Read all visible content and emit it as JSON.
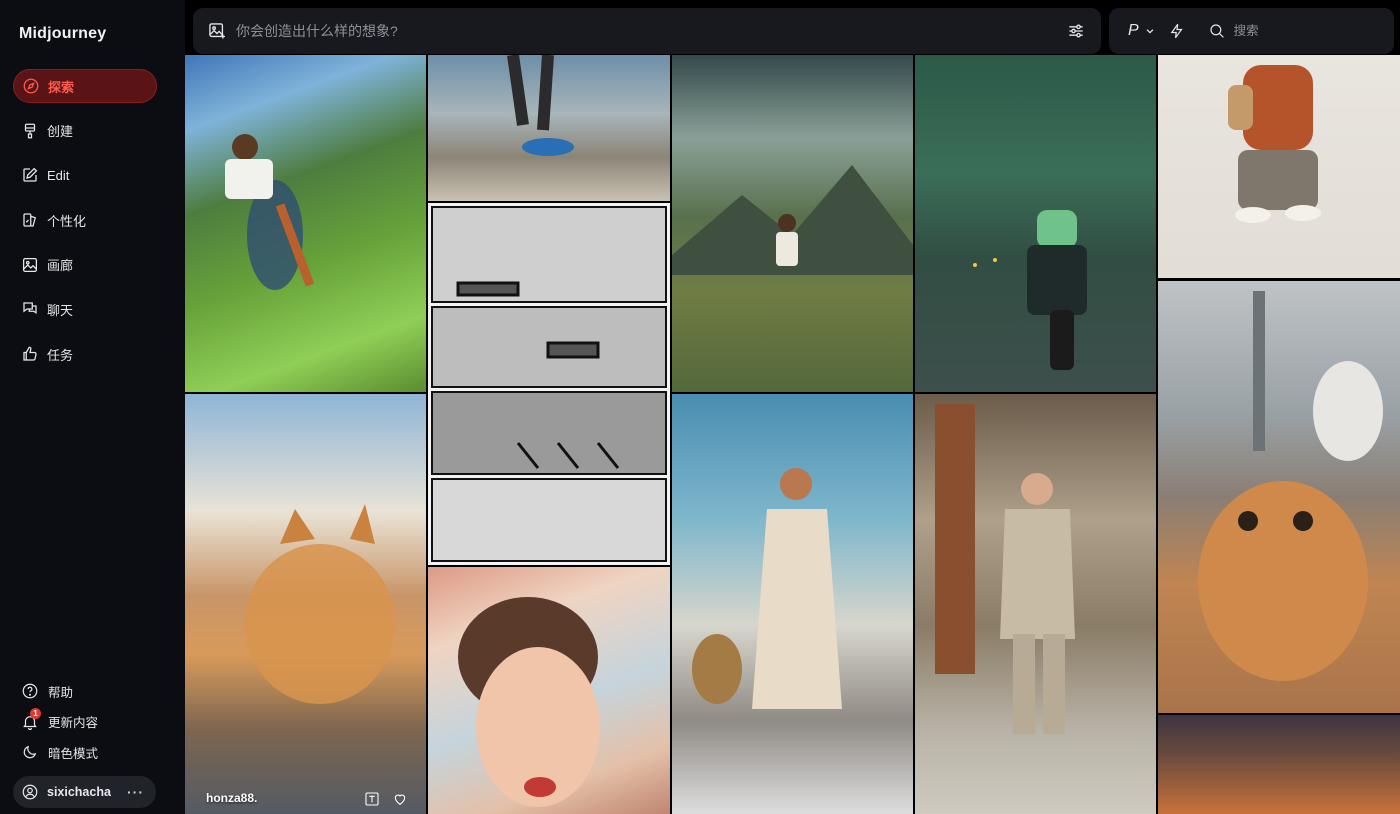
{
  "brand": "Midjourney",
  "nav": [
    {
      "label": "探索",
      "icon": "compass-icon",
      "active": true
    },
    {
      "label": "创建",
      "icon": "brush-icon"
    },
    {
      "label": "Edit",
      "icon": "edit-icon"
    },
    {
      "label": "个性化",
      "icon": "personalize-icon"
    },
    {
      "label": "画廊",
      "icon": "image-icon"
    },
    {
      "label": "聊天",
      "icon": "chat-icon"
    },
    {
      "label": "任务",
      "icon": "thumbs-up-icon"
    }
  ],
  "bottom": [
    {
      "label": "帮助",
      "icon": "help-icon"
    },
    {
      "label": "更新内容",
      "icon": "bell-icon",
      "badge": "1"
    },
    {
      "label": "暗色模式",
      "icon": "moon-icon"
    }
  ],
  "user": {
    "name": "sixichacha",
    "more": "···"
  },
  "topbar": {
    "prompt_placeholder": "你会创造出什么样的想象?",
    "p_label": "P",
    "search_placeholder": "搜索"
  },
  "tiles": {
    "cat_giant": {
      "author": "honza88."
    }
  },
  "colors": {
    "accent": "#ff5a4f",
    "active_bg": "#5a1416",
    "bg": "#0b0d12"
  }
}
